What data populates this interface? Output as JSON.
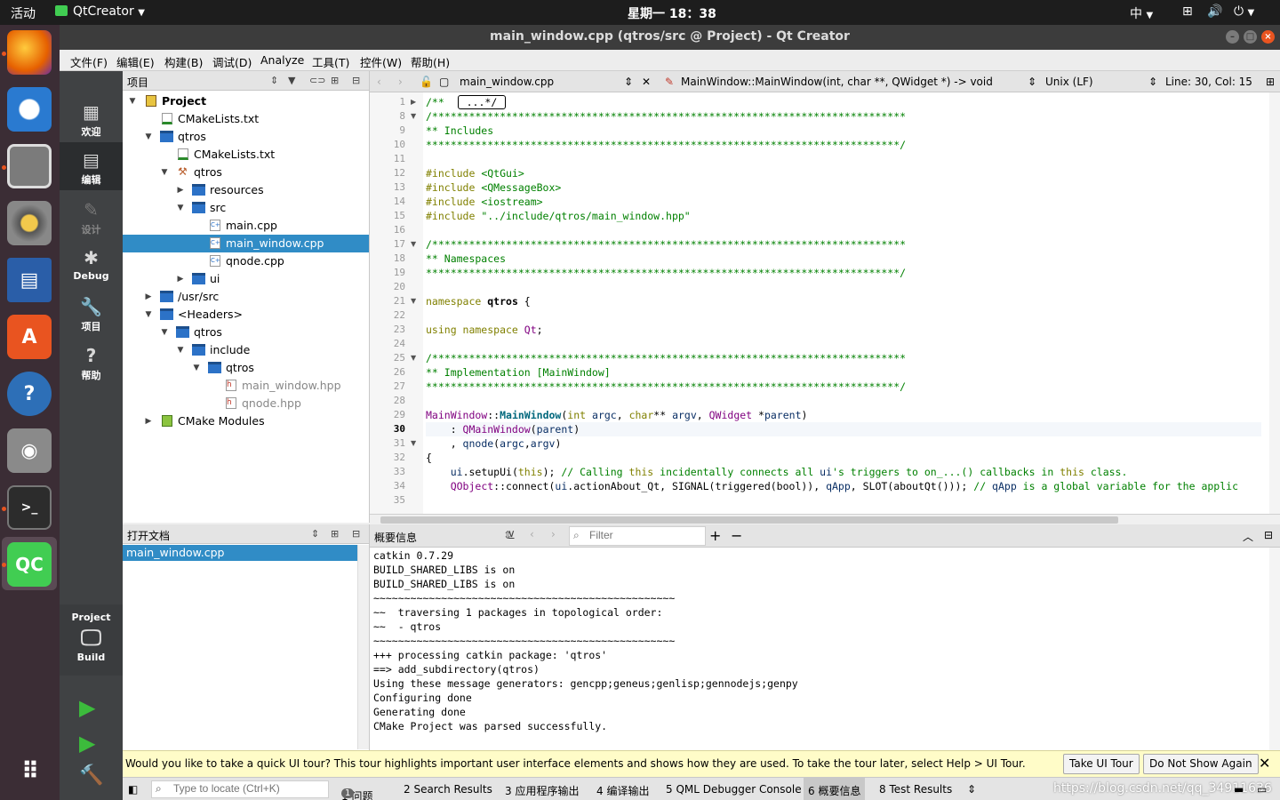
{
  "topbar": {
    "activities": "活动",
    "app": "QtCreator",
    "clock": "星期一 18：38",
    "ime": "中",
    "power": "⏻"
  },
  "window": {
    "title": "main_window.cpp (qtros/src @ Project) - Qt Creator"
  },
  "menu": [
    "文件(F)",
    "编辑(E)",
    "构建(B)",
    "调试(D)",
    "Analyze",
    "工具(T)",
    "控件(W)",
    "帮助(H)"
  ],
  "modes": [
    {
      "label": "欢迎",
      "icon": "grid-icon"
    },
    {
      "label": "编辑",
      "icon": "edit-icon"
    },
    {
      "label": "设计",
      "icon": "design-icon"
    },
    {
      "label": "Debug",
      "icon": "bug-icon"
    },
    {
      "label": "项目",
      "icon": "wrench-icon"
    },
    {
      "label": "帮助",
      "icon": "help-icon"
    }
  ],
  "kit": {
    "project": "Project",
    "build": "Build"
  },
  "project_panel": {
    "title": "项目",
    "tree": [
      {
        "label": "Project",
        "depth": 0,
        "arrow": "▼",
        "icon": "project",
        "bold": true
      },
      {
        "label": "CMakeLists.txt",
        "depth": 1,
        "arrow": "",
        "icon": "cmake"
      },
      {
        "label": "qtros",
        "depth": 1,
        "arrow": "▼",
        "icon": "cmake-folder"
      },
      {
        "label": "CMakeLists.txt",
        "depth": 2,
        "arrow": "",
        "icon": "cmake"
      },
      {
        "label": "qtros",
        "depth": 2,
        "arrow": "▼",
        "icon": "hammer"
      },
      {
        "label": "resources",
        "depth": 3,
        "arrow": "▶",
        "icon": "folder"
      },
      {
        "label": "src",
        "depth": 3,
        "arrow": "▼",
        "icon": "folder"
      },
      {
        "label": "main.cpp",
        "depth": 4,
        "arrow": "",
        "icon": "cpp"
      },
      {
        "label": "main_window.cpp",
        "depth": 4,
        "arrow": "",
        "icon": "cpp",
        "selected": true
      },
      {
        "label": "qnode.cpp",
        "depth": 4,
        "arrow": "",
        "icon": "cpp"
      },
      {
        "label": "ui",
        "depth": 3,
        "arrow": "▶",
        "icon": "folder"
      },
      {
        "label": "/usr/src",
        "depth": 1,
        "arrow": "▶",
        "icon": "folder"
      },
      {
        "label": "<Headers>",
        "depth": 1,
        "arrow": "▼",
        "icon": "headers"
      },
      {
        "label": "qtros",
        "depth": 2,
        "arrow": "▼",
        "icon": "folder"
      },
      {
        "label": "include",
        "depth": 3,
        "arrow": "▼",
        "icon": "folder"
      },
      {
        "label": "qtros",
        "depth": 4,
        "arrow": "▼",
        "icon": "folder"
      },
      {
        "label": "main_window.hpp",
        "depth": 5,
        "arrow": "",
        "icon": "h",
        "dim": true
      },
      {
        "label": "qnode.hpp",
        "depth": 5,
        "arrow": "",
        "icon": "h",
        "dim": true
      },
      {
        "label": "CMake Modules",
        "depth": 1,
        "arrow": "▶",
        "icon": "modules"
      }
    ]
  },
  "open_docs": {
    "title": "打开文档",
    "items": [
      "main_window.cpp"
    ]
  },
  "editor": {
    "file": "main_window.cpp",
    "symbol": "MainWindow::MainWindow(int, char **, QWidget *) -> void",
    "line_ending": "Unix (LF)",
    "position": "Line: 30, Col: 15",
    "lines": [
      {
        "n": "1",
        "fold": "▶",
        "t": "/** ",
        "x": " ...*/ "
      },
      {
        "n": "8",
        "fold": "▼",
        "t": "/*****************************************************************************",
        "c": "com"
      },
      {
        "n": "9",
        "t": "** Includes",
        "c": "com"
      },
      {
        "n": "10",
        "t": "*****************************************************************************/",
        "c": "com"
      },
      {
        "n": "11",
        "t": ""
      },
      {
        "n": "12",
        "k": "#include ",
        "s": "<QtGui>"
      },
      {
        "n": "13",
        "k": "#include ",
        "s": "<QMessageBox>"
      },
      {
        "n": "14",
        "k": "#include ",
        "s": "<iostream>"
      },
      {
        "n": "15",
        "k": "#include ",
        "s": "\"../include/qtros/main_window.hpp\""
      },
      {
        "n": "16",
        "t": ""
      },
      {
        "n": "17",
        "fold": "▼",
        "t": "/*****************************************************************************",
        "c": "com"
      },
      {
        "n": "18",
        "t": "** Namespaces",
        "c": "com"
      },
      {
        "n": "19",
        "t": "*****************************************************************************/",
        "c": "com"
      },
      {
        "n": "20",
        "t": ""
      },
      {
        "n": "21",
        "fold": "▼",
        "k": "namespace ",
        "b": "qtros",
        " r": " {"
      },
      {
        "n": "22",
        "t": ""
      },
      {
        "n": "23",
        "k": "using namespace ",
        "y": "Qt",
        "r": ";"
      },
      {
        "n": "24",
        "t": ""
      },
      {
        "n": "25",
        "fold": "▼",
        "t": "/*****************************************************************************",
        "c": "com"
      },
      {
        "n": "26",
        "t": "** Implementation [MainWindow]",
        "c": "com"
      },
      {
        "n": "27",
        "t": "*****************************************************************************/",
        "c": "com"
      },
      {
        "n": "28",
        "t": ""
      },
      {
        "n": "29",
        "t": "MainWindow::MainWindow(int argc, char** argv, QWidget *parent)"
      },
      {
        "n": "30",
        "t": "    : QMainWindow(parent)",
        "cur": true
      },
      {
        "n": "31",
        "fold": "▼",
        "t": "    , qnode(argc,argv)"
      },
      {
        "n": "32",
        "t": "{"
      },
      {
        "n": "33",
        "t": "    ui.setupUi(this); // Calling this incidentally connects all ui's triggers to on_...() callbacks in this class."
      },
      {
        "n": "34",
        "t": "    QObject::connect(ui.actionAbout_Qt, SIGNAL(triggered(bool)), qApp, SLOT(aboutQt())); // qApp is a global variable for the applic"
      },
      {
        "n": "35",
        "t": ""
      }
    ]
  },
  "output": {
    "title": "概要信息",
    "filter_placeholder": "Filter",
    "lines": [
      "catkin 0.7.29",
      "BUILD_SHARED_LIBS is on",
      "BUILD_SHARED_LIBS is on",
      "~~~~~~~~~~~~~~~~~~~~~~~~~~~~~~~~~~~~~~~~~~~~~~~~~",
      "~~  traversing 1 packages in topological order:",
      "~~  - qtros",
      "~~~~~~~~~~~~~~~~~~~~~~~~~~~~~~~~~~~~~~~~~~~~~~~~~",
      "+++ processing catkin package: 'qtros'",
      "==> add_subdirectory(qtros)",
      "Using these message generators: gencpp;geneus;genlisp;gennodejs;genpy",
      "Configuring done",
      "Generating done",
      "CMake Project was parsed successfully."
    ]
  },
  "tour": {
    "message": "Would you like to take a quick UI tour? This tour highlights important user interface elements and shows how they are used. To take the tour later, select Help > UI Tour.",
    "take": "Take UI Tour",
    "dismiss": "Do Not Show Again"
  },
  "status": {
    "locate_placeholder": "Type to locate (Ctrl+K)",
    "tabs": [
      "1  问题",
      "2  Search Results",
      "3  应用程序输出",
      "4  编译输出",
      "5  QML Debugger Console",
      "6  概要信息",
      "8  Test Results"
    ],
    "issues_count": "1",
    "watermark": "https://blog.csdn.net/qq_34911636"
  }
}
